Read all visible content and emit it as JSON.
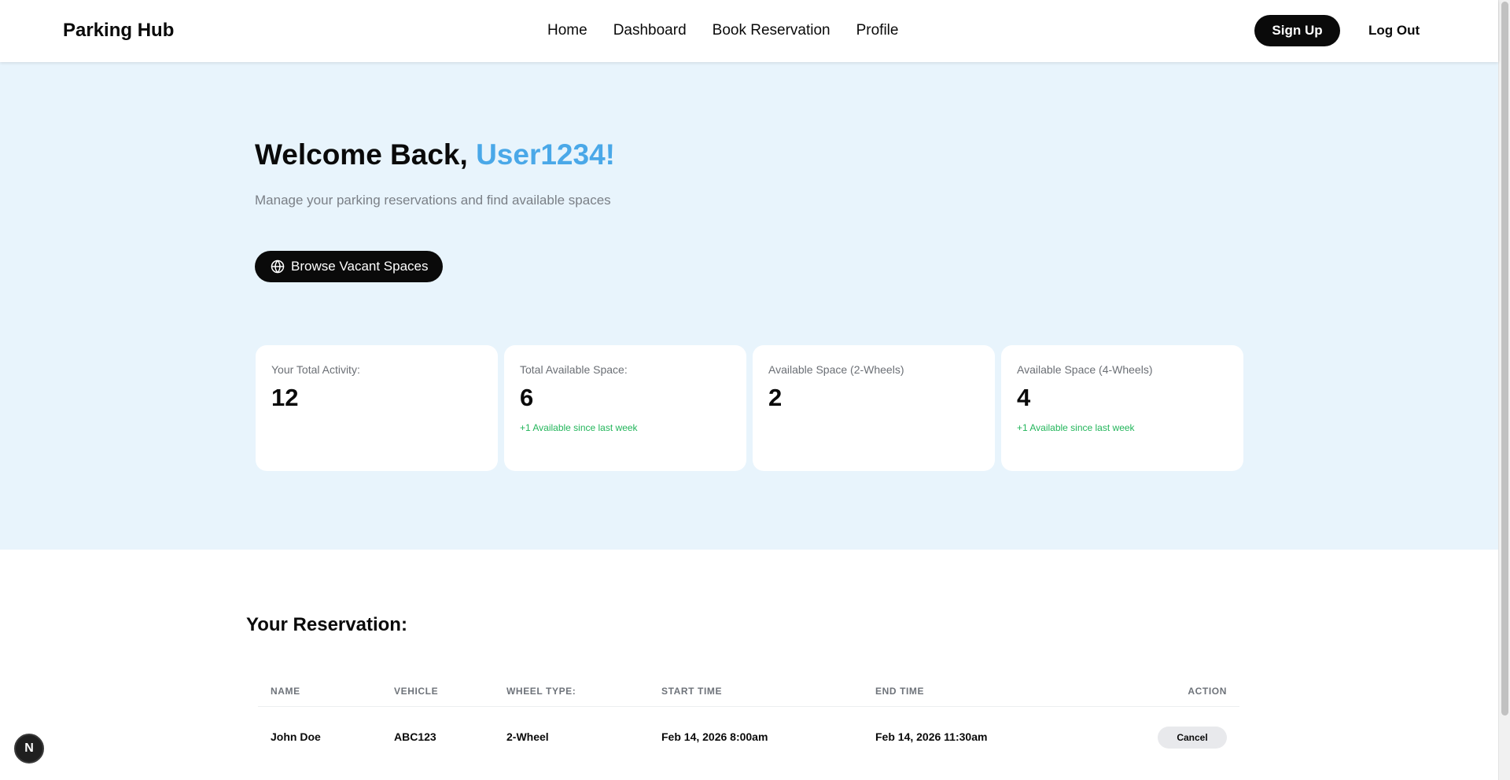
{
  "header": {
    "brand": "Parking Hub",
    "nav": [
      "Home",
      "Dashboard",
      "Book Reservation",
      "Profile"
    ],
    "signup_label": "Sign Up",
    "logout_label": "Log Out"
  },
  "hero": {
    "welcome_prefix": "Welcome Back, ",
    "username": "User1234!",
    "subtitle": "Manage your parking reservations and find available spaces",
    "browse_label": "Browse Vacant Spaces",
    "browse_icon": "globe-icon",
    "accent_color": "#4aa8e8"
  },
  "stats": [
    {
      "label": "Your Total Activity:",
      "value": "12",
      "note": ""
    },
    {
      "label": "Total Available Space:",
      "value": "6",
      "note": "+1 Available since last week"
    },
    {
      "label": "Available Space (2-Wheels)",
      "value": "2",
      "note": ""
    },
    {
      "label": "Available Space (4-Wheels)",
      "value": "4",
      "note": "+1 Available since last week"
    }
  ],
  "reservation": {
    "title": "Your Reservation:",
    "columns": [
      "NAME",
      "VEHICLE",
      "WHEEL TYPE:",
      "START TIME",
      "END TIME",
      "ACTION"
    ],
    "rows": [
      {
        "name": "John Doe",
        "vehicle": "ABC123",
        "wheel_type": "2-Wheel",
        "start_time": "Feb 14, 2026 8:00am",
        "end_time": "Feb 14, 2026 11:30am",
        "action_label": "Cancel"
      }
    ]
  },
  "badge": {
    "letter": "N"
  }
}
